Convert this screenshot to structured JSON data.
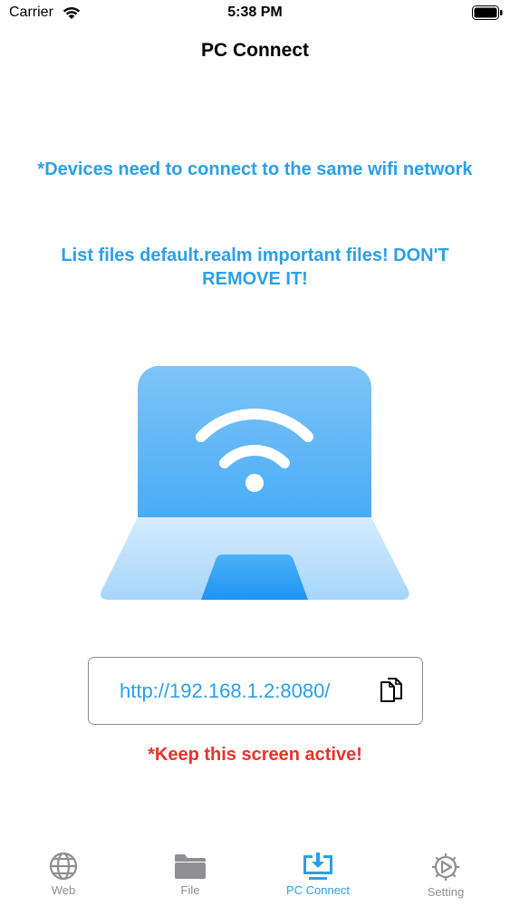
{
  "status_bar": {
    "carrier": "Carrier",
    "time": "5:38 PM"
  },
  "nav": {
    "title": "PC Connect"
  },
  "notices": {
    "line1": "*Devices need to connect to the same wifi network",
    "line2": "List files default.realm important files! DON'T REMOVE IT!"
  },
  "connection": {
    "url": "http://192.168.1.2:8080/"
  },
  "warning": "*Keep this screen active!",
  "tabs": [
    {
      "label": "Web",
      "icon": "globe-icon",
      "active": false
    },
    {
      "label": "File",
      "icon": "folder-icon",
      "active": false
    },
    {
      "label": "PC Connect",
      "icon": "monitor-download-icon",
      "active": true
    },
    {
      "label": "Setting",
      "icon": "gear-icon",
      "active": false
    }
  ],
  "colors": {
    "accent": "#2b9fe8",
    "warning": "#e7332b",
    "inactive_tab": "#8e8e93"
  }
}
